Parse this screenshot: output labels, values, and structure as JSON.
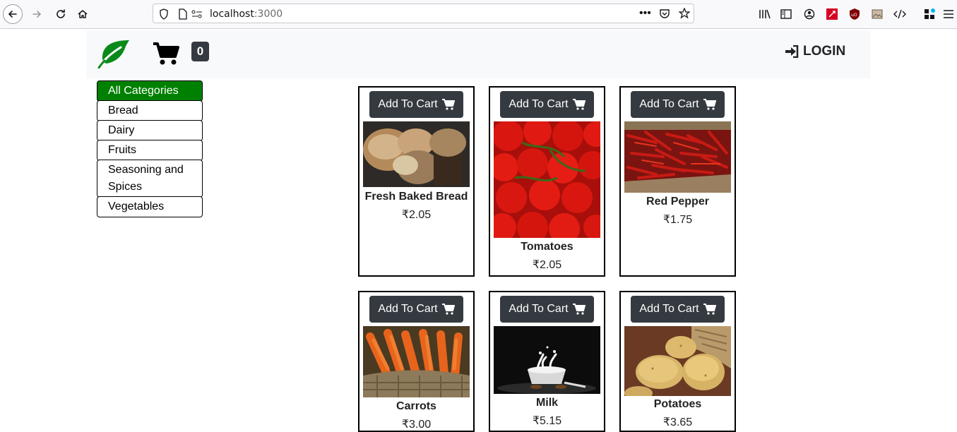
{
  "browser": {
    "url_host": "localhost",
    "url_port": ":3000"
  },
  "header": {
    "cart_count": "0",
    "login_label": "LOGIN"
  },
  "categories": [
    {
      "label": "All Categories"
    },
    {
      "label": "Bread"
    },
    {
      "label": "Dairy"
    },
    {
      "label": "Fruits"
    },
    {
      "label": "Seasoning and Spices"
    },
    {
      "label": "Vegetables"
    }
  ],
  "products": [
    {
      "name": "Fresh Baked Bread",
      "price": "₹2.05",
      "button": "Add To Cart"
    },
    {
      "name": "Tomatoes",
      "price": "₹2.05",
      "button": "Add To Cart"
    },
    {
      "name": "Red Pepper",
      "price": "₹1.75",
      "button": "Add To Cart"
    },
    {
      "name": "Carrots",
      "price": "₹3.00",
      "button": "Add To Cart"
    },
    {
      "name": "Milk",
      "price": "₹5.15",
      "button": "Add To Cart"
    },
    {
      "name": "Potatoes",
      "price": "₹3.65",
      "button": "Add To Cart"
    }
  ],
  "colors": {
    "accent_green": "#008000",
    "dark_button": "#343a40",
    "header_bg": "#f8f9fa"
  }
}
